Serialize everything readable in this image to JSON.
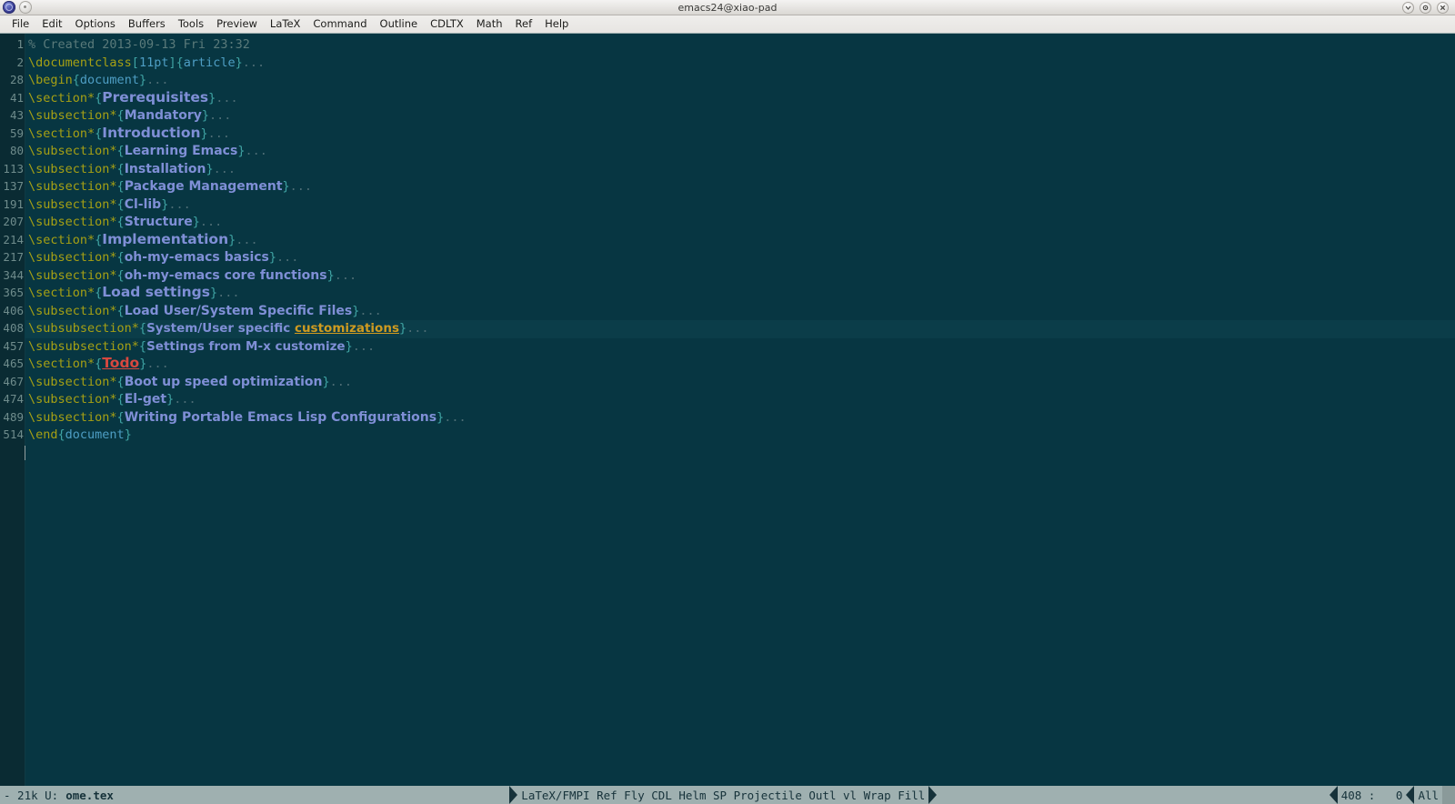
{
  "window": {
    "title": "emacs24@xiao-pad",
    "app_icon": "emacs-globe-icon",
    "secondary_icon": "buffer-dot-icon",
    "controls": [
      {
        "name": "minimize-button",
        "glyph": "ˇ"
      },
      {
        "name": "maximize-button",
        "glyph": "⚙"
      },
      {
        "name": "close-button",
        "glyph": "✕"
      }
    ]
  },
  "menubar": {
    "items": [
      "File",
      "Edit",
      "Options",
      "Buffers",
      "Tools",
      "Preview",
      "LaTeX",
      "Command",
      "Outline",
      "CDLTX",
      "Math",
      "Ref",
      "Help"
    ]
  },
  "colors": {
    "background": "#073642",
    "gutter": "#0a2b33",
    "current_line": "#0b3d49",
    "line_number": "#6f8c8c",
    "macro": "#a6a014",
    "brace": "#3fa3a3",
    "argument": "#4e9ec4",
    "section_title": "#7f8fd6",
    "spell_warning": "#cf9b20",
    "todo": "#d8483f",
    "modeline_bg": "#9fb0b0",
    "modeline_fg": "#16323a",
    "menubar_bg": "#e7e5e2"
  },
  "buffer": {
    "lines": [
      {
        "num": "1",
        "current": false,
        "parts": [
          {
            "t": "% Created 2013-09-13 Fri 23:32",
            "f": "comment"
          }
        ]
      },
      {
        "num": "2",
        "current": false,
        "parts": [
          {
            "t": "\\documentclass",
            "f": "macro"
          },
          {
            "t": "[",
            "f": "brace"
          },
          {
            "t": "11pt",
            "f": "arg"
          },
          {
            "t": "]",
            "f": "brace"
          },
          {
            "t": "{",
            "f": "brace"
          },
          {
            "t": "article",
            "f": "arg"
          },
          {
            "t": "}",
            "f": "brace"
          },
          {
            "t": "...",
            "f": "ellipsis"
          }
        ]
      },
      {
        "num": "28",
        "current": false,
        "parts": [
          {
            "t": "\\begin",
            "f": "macro"
          },
          {
            "t": "{",
            "f": "brace"
          },
          {
            "t": "document",
            "f": "arg"
          },
          {
            "t": "}",
            "f": "brace"
          },
          {
            "t": "...",
            "f": "ellipsis"
          }
        ]
      },
      {
        "num": "41",
        "current": false,
        "parts": [
          {
            "t": "\\section*",
            "f": "macro"
          },
          {
            "t": "{",
            "f": "brace"
          },
          {
            "t": "Prerequisites",
            "f": "sec"
          },
          {
            "t": "}",
            "f": "brace"
          },
          {
            "t": "...",
            "f": "ellipsis"
          }
        ]
      },
      {
        "num": "43",
        "current": false,
        "parts": [
          {
            "t": "\\subsection*",
            "f": "macro"
          },
          {
            "t": "{",
            "f": "brace"
          },
          {
            "t": "Mandatory",
            "f": "subsec"
          },
          {
            "t": "}",
            "f": "brace"
          },
          {
            "t": "...",
            "f": "ellipsis"
          }
        ]
      },
      {
        "num": "59",
        "current": false,
        "parts": [
          {
            "t": "\\section*",
            "f": "macro"
          },
          {
            "t": "{",
            "f": "brace"
          },
          {
            "t": "Introduction",
            "f": "sec"
          },
          {
            "t": "}",
            "f": "brace"
          },
          {
            "t": "...",
            "f": "ellipsis"
          }
        ]
      },
      {
        "num": "80",
        "current": false,
        "parts": [
          {
            "t": "\\subsection*",
            "f": "macro"
          },
          {
            "t": "{",
            "f": "brace"
          },
          {
            "t": "Learning Emacs",
            "f": "subsec"
          },
          {
            "t": "}",
            "f": "brace"
          },
          {
            "t": "...",
            "f": "ellipsis"
          }
        ]
      },
      {
        "num": "113",
        "current": false,
        "parts": [
          {
            "t": "\\subsection*",
            "f": "macro"
          },
          {
            "t": "{",
            "f": "brace"
          },
          {
            "t": "Installation",
            "f": "subsec"
          },
          {
            "t": "}",
            "f": "brace"
          },
          {
            "t": "...",
            "f": "ellipsis"
          }
        ]
      },
      {
        "num": "137",
        "current": false,
        "parts": [
          {
            "t": "\\subsection*",
            "f": "macro"
          },
          {
            "t": "{",
            "f": "brace"
          },
          {
            "t": "Package Management",
            "f": "subsec"
          },
          {
            "t": "}",
            "f": "brace"
          },
          {
            "t": "...",
            "f": "ellipsis"
          }
        ]
      },
      {
        "num": "191",
        "current": false,
        "parts": [
          {
            "t": "\\subsection*",
            "f": "macro"
          },
          {
            "t": "{",
            "f": "brace"
          },
          {
            "t": "Cl-lib",
            "f": "subsec"
          },
          {
            "t": "}",
            "f": "brace"
          },
          {
            "t": "...",
            "f": "ellipsis"
          }
        ]
      },
      {
        "num": "207",
        "current": false,
        "parts": [
          {
            "t": "\\subsection*",
            "f": "macro"
          },
          {
            "t": "{",
            "f": "brace"
          },
          {
            "t": "Structure",
            "f": "subsec"
          },
          {
            "t": "}",
            "f": "brace"
          },
          {
            "t": "...",
            "f": "ellipsis"
          }
        ]
      },
      {
        "num": "214",
        "current": false,
        "parts": [
          {
            "t": "\\section*",
            "f": "macro"
          },
          {
            "t": "{",
            "f": "brace"
          },
          {
            "t": "Implementation",
            "f": "sec"
          },
          {
            "t": "}",
            "f": "brace"
          },
          {
            "t": "...",
            "f": "ellipsis"
          }
        ]
      },
      {
        "num": "217",
        "current": false,
        "parts": [
          {
            "t": "\\subsection*",
            "f": "macro"
          },
          {
            "t": "{",
            "f": "brace"
          },
          {
            "t": "oh-my-emacs basics",
            "f": "subsec"
          },
          {
            "t": "}",
            "f": "brace"
          },
          {
            "t": "...",
            "f": "ellipsis"
          }
        ]
      },
      {
        "num": "344",
        "current": false,
        "parts": [
          {
            "t": "\\subsection*",
            "f": "macro"
          },
          {
            "t": "{",
            "f": "brace"
          },
          {
            "t": "oh-my-emacs core functions",
            "f": "subsec"
          },
          {
            "t": "}",
            "f": "brace"
          },
          {
            "t": "...",
            "f": "ellipsis"
          }
        ]
      },
      {
        "num": "365",
        "current": false,
        "parts": [
          {
            "t": "\\section*",
            "f": "macro"
          },
          {
            "t": "{",
            "f": "brace"
          },
          {
            "t": "Load settings",
            "f": "sec"
          },
          {
            "t": "}",
            "f": "brace"
          },
          {
            "t": "...",
            "f": "ellipsis"
          }
        ]
      },
      {
        "num": "406",
        "current": false,
        "parts": [
          {
            "t": "\\subsection*",
            "f": "macro"
          },
          {
            "t": "{",
            "f": "brace"
          },
          {
            "t": "Load User/System Specific Files",
            "f": "subsec"
          },
          {
            "t": "}",
            "f": "brace"
          },
          {
            "t": "...",
            "f": "ellipsis"
          }
        ]
      },
      {
        "num": "408",
        "current": true,
        "parts": [
          {
            "t": "\\subsubsection*",
            "f": "macro"
          },
          {
            "t": "{",
            "f": "brace"
          },
          {
            "t": "System/User specific ",
            "f": "subsubsec"
          },
          {
            "t": "customizations",
            "f": "spell"
          },
          {
            "t": "}",
            "f": "brace"
          },
          {
            "t": "...",
            "f": "ellipsis"
          }
        ]
      },
      {
        "num": "457",
        "current": false,
        "parts": [
          {
            "t": "\\subsubsection*",
            "f": "macro"
          },
          {
            "t": "{",
            "f": "brace"
          },
          {
            "t": "Settings from M-x customize",
            "f": "subsubsec"
          },
          {
            "t": "}",
            "f": "brace"
          },
          {
            "t": "...",
            "f": "ellipsis"
          }
        ]
      },
      {
        "num": "465",
        "current": false,
        "parts": [
          {
            "t": "\\section*",
            "f": "macro"
          },
          {
            "t": "{",
            "f": "brace"
          },
          {
            "t": "Todo",
            "f": "todo"
          },
          {
            "t": "}",
            "f": "brace"
          },
          {
            "t": "...",
            "f": "ellipsis"
          }
        ]
      },
      {
        "num": "467",
        "current": false,
        "parts": [
          {
            "t": "\\subsection*",
            "f": "macro"
          },
          {
            "t": "{",
            "f": "brace"
          },
          {
            "t": "Boot up speed optimization",
            "f": "subsec"
          },
          {
            "t": "}",
            "f": "brace"
          },
          {
            "t": "...",
            "f": "ellipsis"
          }
        ]
      },
      {
        "num": "474",
        "current": false,
        "parts": [
          {
            "t": "\\subsection*",
            "f": "macro"
          },
          {
            "t": "{",
            "f": "brace"
          },
          {
            "t": "El-get",
            "f": "subsec"
          },
          {
            "t": "}",
            "f": "brace"
          },
          {
            "t": "...",
            "f": "ellipsis"
          }
        ]
      },
      {
        "num": "489",
        "current": false,
        "parts": [
          {
            "t": "\\subsection*",
            "f": "macro"
          },
          {
            "t": "{",
            "f": "brace"
          },
          {
            "t": "Writing Portable Emacs Lisp Configurations",
            "f": "subsec"
          },
          {
            "t": "}",
            "f": "brace"
          },
          {
            "t": "...",
            "f": "ellipsis"
          }
        ]
      },
      {
        "num": "514",
        "current": false,
        "parts": [
          {
            "t": "\\end",
            "f": "macro"
          },
          {
            "t": "{",
            "f": "brace"
          },
          {
            "t": "document",
            "f": "arg"
          },
          {
            "t": "}",
            "f": "brace"
          }
        ]
      }
    ]
  },
  "modeline": {
    "left_status": "- 21k U:",
    "buffer_name": "ome.tex",
    "modes": "LaTeX/FMPI Ref Fly CDL Helm SP Projectile Outl vl Wrap Fill",
    "position": "408 :   0",
    "scroll": "All"
  }
}
